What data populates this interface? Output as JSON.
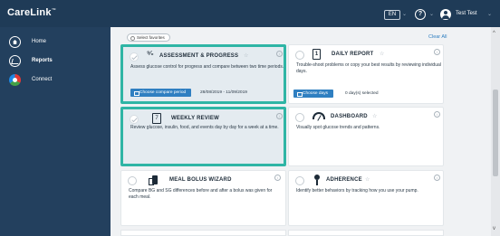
{
  "app": {
    "logo": "CareLink",
    "logo_tm": "™"
  },
  "header": {
    "language": "EN",
    "help": "?",
    "user_name": "Test Test"
  },
  "sidebar": {
    "items": [
      {
        "label": "Home",
        "icon": "home-icon",
        "active": false
      },
      {
        "label": "Reports",
        "icon": "reports-icon",
        "active": true
      },
      {
        "label": "Connect",
        "icon": "connect-icon",
        "active": false
      }
    ]
  },
  "toolbar": {
    "select_favorites": "Select favorites",
    "clear_all": "Clear All"
  },
  "cards": {
    "assessment": {
      "title": "ASSESSMENT & PROGRESS",
      "description": "Assess glucose control for progress and compare between two time periods.",
      "button": "Choose compare period",
      "value": "28/08/2019 - 11/09/2019",
      "selected": true
    },
    "daily": {
      "title": "DAILY REPORT",
      "description": "Trouble-shoot problems or copy your best results by reviewing individual days.",
      "button": "Choose days",
      "value": "0 day(s) selected",
      "selected": false
    },
    "weekly": {
      "title": "WEEKLY REVIEW",
      "description": "Review glucose, insulin, food, and events day by day for a week at a time.",
      "selected": true
    },
    "dashboard": {
      "title": "DASHBOARD",
      "description": "Visually spot glucose trends and patterns.",
      "selected": false
    },
    "bolus": {
      "title": "MEAL BOLUS WIZARD",
      "description": "Compare BG and SG differences before and after a bolus was given for each meal.",
      "selected": false
    },
    "adherence": {
      "title": "ADHERENCE",
      "description": "Identify better behaviors by tracking how you use your pump.",
      "selected": false
    }
  },
  "colors": {
    "topbar": "#1f3b57",
    "sidebar": "#23405e",
    "accent": "#2fb5a5",
    "button": "#2f7fc1"
  }
}
